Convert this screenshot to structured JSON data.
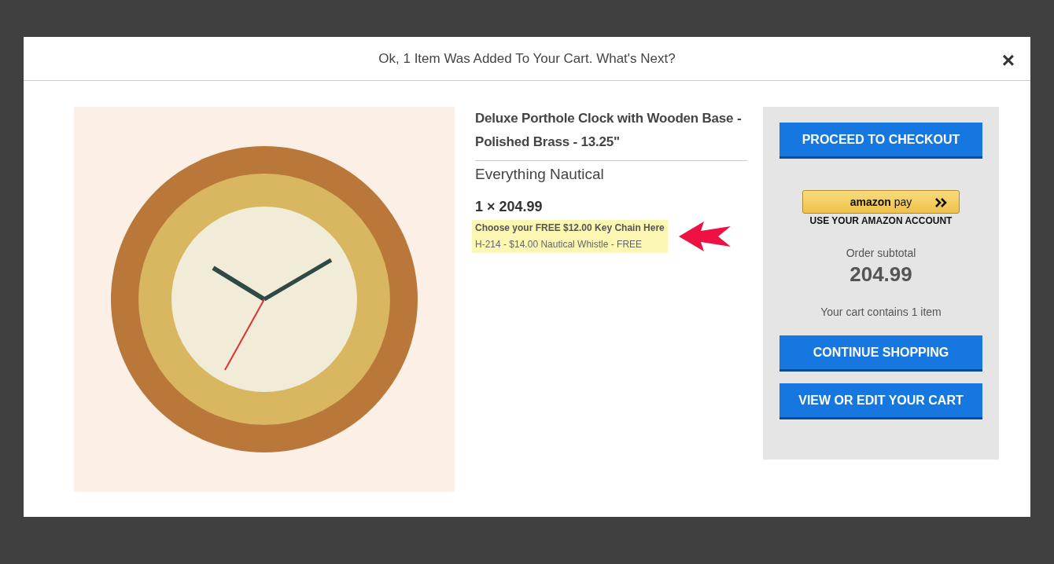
{
  "modal": {
    "title": "Ok, 1 Item Was Added To Your Cart. What's Next?",
    "close": "×"
  },
  "product": {
    "name": "Deluxe Porthole Clock with Wooden Base - Polished Brass - 13.25\"",
    "brand": "Everything Nautical",
    "quantity_price": "1 × 204.99",
    "promo_link": "Choose your FREE $12.00 Key Chain Here",
    "promo_item": "H-214 - $14.00 Nautical Whistle - FREE"
  },
  "cart": {
    "checkout_button": "PROCEED TO CHECKOUT",
    "amazon_pay": {
      "brand": "amazon",
      "pay": "pay",
      "caption": "USE YOUR AMAZON ACCOUNT"
    },
    "subtotal_label": "Order subtotal",
    "subtotal": "204.99",
    "item_count": "Your cart contains 1 item",
    "buttons": [
      "CONTINUE SHOPPING",
      "VIEW OR EDIT YOUR CART"
    ]
  }
}
